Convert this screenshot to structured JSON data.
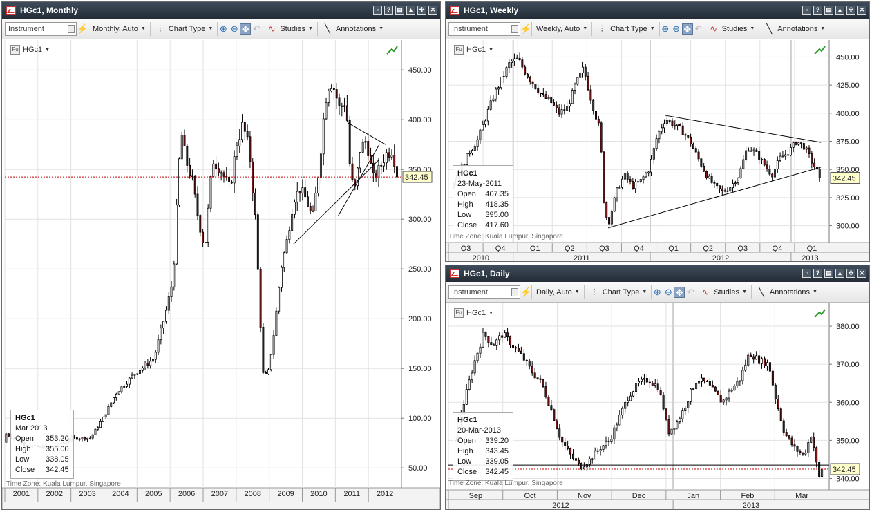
{
  "toolbar": {
    "instrument_placeholder": "Instrument",
    "chart_type_label": "Chart Type",
    "studies_label": "Studies",
    "annotations_label": "Annotations"
  },
  "timezone_label": "Time Zone: Kuala Lumpur, Singapore",
  "colors": {
    "bull": "#ffffff",
    "bear": "#7a1a1a",
    "outline": "#000000",
    "last_line": "#c00000",
    "title_bg": "#2b3540"
  },
  "panes": [
    {
      "id": "monthly",
      "title": "HGc1, Monthly",
      "interval_label": "Monthly, Auto",
      "instrument": "HGc1",
      "info": {
        "name": "HGc1",
        "date": "Mar 2013",
        "open": "353.20",
        "high": "355.00",
        "low": "338.05",
        "close": "342.45"
      },
      "last_price": "342.45",
      "x_ticks": [
        "2001",
        "2002",
        "2003",
        "2004",
        "2005",
        "2006",
        "2007",
        "2008",
        "2009",
        "2010",
        "2011",
        "2012"
      ],
      "y_ticks": [
        "450.00",
        "400.00",
        "350.00",
        "300.00",
        "250.00",
        "200.00",
        "150.00",
        "100.00",
        "50.00"
      ]
    },
    {
      "id": "weekly",
      "title": "HGc1, Weekly",
      "interval_label": "Weekly, Auto",
      "instrument": "HGc1",
      "info": {
        "name": "HGc1",
        "date": "23-May-2011",
        "open": "407.35",
        "high": "418.35",
        "low": "395.00",
        "close": "417.60"
      },
      "last_price": "342.45",
      "x_ticks": [
        "Q3",
        "Q4",
        "Q1",
        "Q2",
        "Q3",
        "Q4",
        "Q1",
        "Q2",
        "Q3",
        "Q4",
        "Q1"
      ],
      "x_years": [
        "2010",
        "2011",
        "2012",
        "2013"
      ],
      "y_ticks": [
        "450.00",
        "425.00",
        "400.00",
        "375.00",
        "350.00",
        "325.00",
        "300.00"
      ]
    },
    {
      "id": "daily",
      "title": "HGc1, Daily",
      "interval_label": "Daily, Auto",
      "instrument": "HGc1",
      "info": {
        "name": "HGc1",
        "date": "20-Mar-2013",
        "open": "339.20",
        "high": "343.45",
        "low": "339.05",
        "close": "342.45"
      },
      "last_price": "342.45",
      "x_ticks": [
        "Sep",
        "Oct",
        "Nov",
        "Dec",
        "Jan",
        "Feb",
        "Mar"
      ],
      "x_years": [
        "2012",
        "2013"
      ],
      "y_ticks": [
        "380.00",
        "370.00",
        "360.00",
        "350.00",
        "340.00"
      ]
    }
  ],
  "chart_data": [
    {
      "type": "candlestick",
      "title": "HGc1, Monthly",
      "x_unit": "year",
      "ylim": [
        30,
        480
      ],
      "last": 342.45,
      "close_path": [
        [
          2000.8,
          85
        ],
        [
          2001.5,
          72
        ],
        [
          2002.3,
          70
        ],
        [
          2002.9,
          80
        ],
        [
          2003.5,
          80
        ],
        [
          2003.9,
          100
        ],
        [
          2004.3,
          125
        ],
        [
          2004.9,
          145
        ],
        [
          2005.5,
          160
        ],
        [
          2005.9,
          210
        ],
        [
          2006.1,
          240
        ],
        [
          2006.35,
          390
        ],
        [
          2006.5,
          360
        ],
        [
          2006.7,
          340
        ],
        [
          2006.9,
          300
        ],
        [
          2007.1,
          270
        ],
        [
          2007.35,
          360
        ],
        [
          2007.6,
          350
        ],
        [
          2007.9,
          330
        ],
        [
          2008.1,
          375
        ],
        [
          2008.3,
          395
        ],
        [
          2008.5,
          370
        ],
        [
          2008.7,
          300
        ],
        [
          2008.85,
          200
        ],
        [
          2008.95,
          140
        ],
        [
          2009.1,
          145
        ],
        [
          2009.3,
          190
        ],
        [
          2009.5,
          250
        ],
        [
          2009.7,
          280
        ],
        [
          2009.9,
          320
        ],
        [
          2010.1,
          330
        ],
        [
          2010.3,
          320
        ],
        [
          2010.5,
          300
        ],
        [
          2010.7,
          350
        ],
        [
          2010.9,
          420
        ],
        [
          2011.05,
          440
        ],
        [
          2011.2,
          430
        ],
        [
          2011.35,
          410
        ],
        [
          2011.55,
          420
        ],
        [
          2011.7,
          340
        ],
        [
          2011.85,
          330
        ],
        [
          2012.0,
          370
        ],
        [
          2012.2,
          380
        ],
        [
          2012.4,
          340
        ],
        [
          2012.6,
          350
        ],
        [
          2012.8,
          365
        ],
        [
          2013.0,
          370
        ],
        [
          2013.2,
          342.45
        ]
      ],
      "triangles": [
        [
          [
            2009.9,
            275
          ],
          [
            2012.6,
            360
          ]
        ],
        [
          [
            2011.3,
            303
          ],
          [
            2012.6,
            375
          ]
        ],
        [
          [
            2011.6,
            397
          ],
          [
            2012.8,
            375
          ]
        ]
      ]
    },
    {
      "type": "candlestick",
      "title": "HGc1, Weekly",
      "x_unit": "months since 2010-06",
      "ylim": [
        285,
        465
      ],
      "last": 342.45,
      "close_path": [
        [
          0,
          335
        ],
        [
          2,
          365
        ],
        [
          3,
          375
        ],
        [
          4,
          395
        ],
        [
          5,
          415
        ],
        [
          6,
          430
        ],
        [
          7,
          445
        ],
        [
          8,
          448
        ],
        [
          9,
          435
        ],
        [
          10,
          425
        ],
        [
          11,
          415
        ],
        [
          12,
          410
        ],
        [
          13,
          400
        ],
        [
          14,
          405
        ],
        [
          15,
          425
        ],
        [
          16,
          440
        ],
        [
          17,
          410
        ],
        [
          18,
          385
        ],
        [
          18.5,
          320
        ],
        [
          19,
          300
        ],
        [
          20,
          330
        ],
        [
          21,
          345
        ],
        [
          22,
          335
        ],
        [
          23,
          340
        ],
        [
          24,
          350
        ],
        [
          25,
          380
        ],
        [
          26,
          395
        ],
        [
          27,
          390
        ],
        [
          28,
          385
        ],
        [
          29,
          375
        ],
        [
          30,
          360
        ],
        [
          31,
          345
        ],
        [
          32,
          335
        ],
        [
          33,
          330
        ],
        [
          34,
          335
        ],
        [
          35,
          345
        ],
        [
          36,
          370
        ],
        [
          37,
          365
        ],
        [
          38,
          355
        ],
        [
          39,
          345
        ],
        [
          40,
          360
        ],
        [
          41,
          365
        ],
        [
          42,
          375
        ],
        [
          43,
          370
        ],
        [
          44,
          355
        ],
        [
          45,
          342.45
        ]
      ],
      "trendlines": [
        [
          [
            19,
            298
          ],
          [
            45,
            352
          ]
        ],
        [
          [
            26,
            398
          ],
          [
            45,
            374
          ]
        ]
      ]
    },
    {
      "type": "candlestick",
      "title": "HGc1, Daily",
      "x_unit": "days since 2012-08-21",
      "ylim": [
        337,
        386
      ],
      "last": 342.45,
      "close_path": [
        [
          0,
          350
        ],
        [
          5,
          360
        ],
        [
          10,
          370
        ],
        [
          15,
          378
        ],
        [
          20,
          375
        ],
        [
          25,
          378
        ],
        [
          30,
          375
        ],
        [
          35,
          372
        ],
        [
          40,
          368
        ],
        [
          45,
          365
        ],
        [
          50,
          358
        ],
        [
          55,
          350
        ],
        [
          60,
          346
        ],
        [
          65,
          343
        ],
        [
          70,
          345
        ],
        [
          75,
          348
        ],
        [
          80,
          350
        ],
        [
          85,
          356
        ],
        [
          90,
          362
        ],
        [
          95,
          365
        ],
        [
          100,
          366
        ],
        [
          105,
          364
        ],
        [
          108,
          358
        ],
        [
          110,
          352
        ],
        [
          115,
          355
        ],
        [
          118,
          358
        ],
        [
          122,
          363
        ],
        [
          125,
          366
        ],
        [
          130,
          365
        ],
        [
          135,
          362
        ],
        [
          138,
          360
        ],
        [
          142,
          363
        ],
        [
          147,
          366
        ],
        [
          152,
          373
        ],
        [
          157,
          371
        ],
        [
          162,
          370
        ],
        [
          165,
          362
        ],
        [
          170,
          352
        ],
        [
          175,
          348
        ],
        [
          180,
          346
        ],
        [
          184,
          352
        ],
        [
          186,
          345
        ],
        [
          188,
          340
        ],
        [
          190,
          342.45
        ]
      ],
      "support": 343.5
    }
  ]
}
